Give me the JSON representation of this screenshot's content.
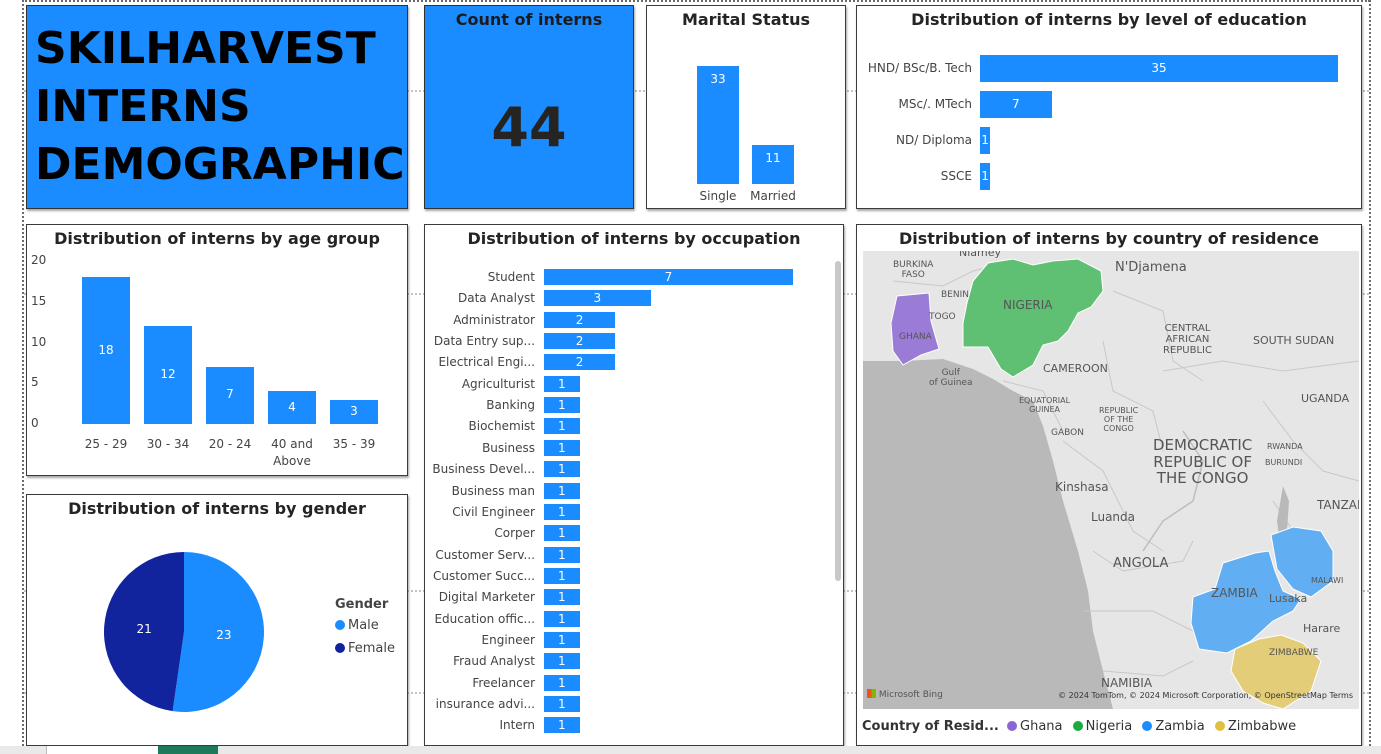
{
  "title_card": {
    "line1": "SKILHARVEST",
    "line2": "INTERNS",
    "line3": "DEMOGRAPHICS"
  },
  "kpi": {
    "label": "Count of interns",
    "value": "44"
  },
  "marital": {
    "title": "Marital Status",
    "categories": [
      "Single",
      "Married"
    ],
    "values": [
      33,
      11
    ]
  },
  "education": {
    "title": "Distribution of interns by level of education",
    "categories": [
      "HND/ BSc/B. Tech",
      "MSc/. MTech",
      "ND/ Diploma",
      "SSCE"
    ],
    "values": [
      35,
      7,
      1,
      1
    ]
  },
  "age": {
    "title": "Distribution of interns by age group",
    "categories": [
      "25 - 29",
      "30 - 34",
      "20 - 24",
      "40 and Above",
      "35 - 39"
    ],
    "values": [
      18,
      12,
      7,
      4,
      3
    ],
    "yticks": [
      "20",
      "15",
      "10",
      "5",
      "0"
    ]
  },
  "occupation": {
    "title": "Distribution of interns by occupation",
    "categories": [
      "Student",
      "Data Analyst",
      "Administrator",
      "Data Entry sup...",
      "Electrical Engi...",
      "Agriculturist",
      "Banking",
      "Biochemist",
      "Business",
      "Business Devel...",
      "Business man",
      "Civil Engineer",
      "Corper",
      "Customer Serv...",
      "Customer Succ...",
      "Digital Marketer",
      "Education offic...",
      "Engineer",
      "Fraud Analyst",
      "Freelancer",
      "insurance advi...",
      "Intern"
    ],
    "values": [
      7,
      3,
      2,
      2,
      2,
      1,
      1,
      1,
      1,
      1,
      1,
      1,
      1,
      1,
      1,
      1,
      1,
      1,
      1,
      1,
      1,
      1
    ]
  },
  "gender": {
    "title": "Distribution of interns by gender",
    "legend_title": "Gender",
    "labels": [
      "Male",
      "Female"
    ],
    "values": [
      23,
      21
    ],
    "colors": [
      "#1a8cff",
      "#12239e"
    ]
  },
  "map": {
    "title": "Distribution of interns by country of residence",
    "labels": {
      "nigeria": "NIGERIA",
      "ghana": "GHANA",
      "togo": "TOGO",
      "benin": "BENIN",
      "burkina": "BURKINA\nFASO",
      "niamey": "Niamey",
      "ndjamena": "N'Djamena",
      "car": "CENTRAL\nAFRICAN\nREPUBLIC",
      "south_sudan": "SOUTH SUDAN",
      "cameroon": "CAMEROON",
      "gulf": "Gulf\nof Guinea",
      "eq_guinea": "EQUATORIAL\nGUINEA",
      "rep_congo": "REPUBLIC\nOF THE\nCONGO",
      "gabon": "GABON",
      "drc": "DEMOCRATIC\nREPUBLIC OF\nTHE CONGO",
      "uganda": "UGANDA",
      "rwanda": "RWANDA",
      "burundi": "BURUNDI",
      "kinshasa": "Kinshasa",
      "luanda": "Luanda",
      "tanzania": "TANZAN",
      "angola": "ANGOLA",
      "zambia": "ZAMBIA",
      "lusaka": "Lusaka",
      "malawi": "MALAWI",
      "harare": "Harare",
      "zimbabwe": "ZIMBABWE",
      "namibia": "NAMIBIA"
    },
    "bing": "Microsoft Bing",
    "copyright": "© 2024 TomTom, © 2024 Microsoft Corporation, © OpenStreetMap  Terms",
    "legend_title": "Country of Resid...",
    "legend_items": [
      "Ghana",
      "Nigeria",
      "Zambia",
      "Zimbabwe"
    ],
    "legend_colors": [
      "#8b65d6",
      "#1aab40",
      "#1a8cff",
      "#e0c040"
    ],
    "land_color": "#e6e6e6",
    "water_color": "#b8b8b8"
  }
}
